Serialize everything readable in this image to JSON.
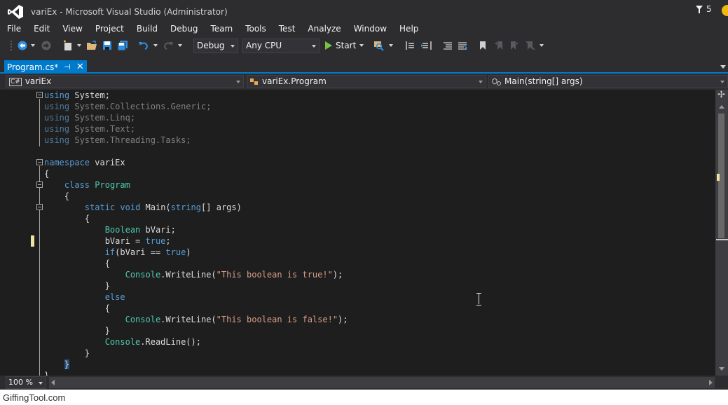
{
  "window": {
    "title": "variEx - Microsoft Visual Studio (Administrator)",
    "notification_count": "5",
    "logo_icon": "visual-studio-logo-icon"
  },
  "menu": [
    "File",
    "Edit",
    "View",
    "Project",
    "Build",
    "Debug",
    "Team",
    "Tools",
    "Test",
    "Analyze",
    "Window",
    "Help"
  ],
  "toolbar": {
    "configuration": "Debug",
    "platform": "Any CPU",
    "start_label": "Start"
  },
  "tab": {
    "label": "Program.cs*",
    "pin_icon": "pin-icon",
    "close_icon": "close-icon"
  },
  "navbar": {
    "project": "variEx",
    "class": "variEx.Program",
    "member": "Main(string[] args)"
  },
  "editor": {
    "zoom": "100 %",
    "lines": [
      [
        "<span class=\"k\">using</span> System;"
      ],
      [
        "<span class=\"k\">using</span> System.Collections.Generic;"
      ],
      [
        "<span class=\"k\">using</span> System.Linq;"
      ],
      [
        "<span class=\"k\">using</span> System.Text;"
      ],
      [
        "<span class=\"k\">using</span> System.Threading.Tasks;"
      ]
    ]
  },
  "code": [
    {
      "row": 0,
      "fold": true,
      "dim": false,
      "parts": [
        [
          "k",
          "using"
        ],
        [
          "",
          " System;"
        ]
      ]
    },
    {
      "row": 1,
      "fold": false,
      "dim": true,
      "parts": [
        [
          "k",
          "using"
        ],
        [
          "",
          " System.Collections.Generic;"
        ]
      ]
    },
    {
      "row": 2,
      "fold": false,
      "dim": true,
      "parts": [
        [
          "k",
          "using"
        ],
        [
          "",
          " System.Linq;"
        ]
      ]
    },
    {
      "row": 3,
      "fold": false,
      "dim": true,
      "parts": [
        [
          "k",
          "using"
        ],
        [
          "",
          " System.Text;"
        ]
      ]
    },
    {
      "row": 4,
      "fold": false,
      "dim": true,
      "parts": [
        [
          "k",
          "using"
        ],
        [
          "",
          " System.Threading.Tasks;"
        ]
      ]
    },
    {
      "row": 6,
      "fold": true,
      "dim": false,
      "parts": [
        [
          "k",
          "namespace"
        ],
        [
          "",
          " variEx"
        ]
      ]
    },
    {
      "row": 7,
      "fold": false,
      "dim": false,
      "parts": [
        [
          "",
          "{"
        ]
      ]
    },
    {
      "row": 8,
      "fold": true,
      "dim": false,
      "parts": [
        [
          "",
          "    "
        ],
        [
          "k",
          "class"
        ],
        [
          "",
          " "
        ],
        [
          "t",
          "Program"
        ]
      ]
    },
    {
      "row": 9,
      "fold": false,
      "dim": false,
      "parts": [
        [
          "",
          "    {"
        ]
      ]
    },
    {
      "row": 10,
      "fold": true,
      "dim": false,
      "parts": [
        [
          "",
          "        "
        ],
        [
          "k",
          "static"
        ],
        [
          "",
          " "
        ],
        [
          "k",
          "void"
        ],
        [
          "",
          " Main("
        ],
        [
          "k",
          "string"
        ],
        [
          "",
          "[] args)"
        ]
      ]
    },
    {
      "row": 11,
      "fold": false,
      "dim": false,
      "parts": [
        [
          "",
          "        {"
        ]
      ]
    },
    {
      "row": 12,
      "fold": false,
      "dim": false,
      "parts": [
        [
          "",
          "            "
        ],
        [
          "t",
          "Boolean"
        ],
        [
          "",
          " bVari;"
        ]
      ]
    },
    {
      "row": 13,
      "fold": false,
      "dim": false,
      "parts": [
        [
          "",
          "            bVari = "
        ],
        [
          "k",
          "true"
        ],
        [
          "",
          ";"
        ]
      ]
    },
    {
      "row": 14,
      "fold": false,
      "dim": false,
      "parts": [
        [
          "",
          "            "
        ],
        [
          "k",
          "if"
        ],
        [
          "",
          "(bVari == "
        ],
        [
          "k",
          "true"
        ],
        [
          "",
          ")"
        ]
      ]
    },
    {
      "row": 15,
      "fold": false,
      "dim": false,
      "parts": [
        [
          "",
          "            {"
        ]
      ]
    },
    {
      "row": 16,
      "fold": false,
      "dim": false,
      "parts": [
        [
          "",
          "                "
        ],
        [
          "t",
          "Console"
        ],
        [
          "",
          ".WriteLine("
        ],
        [
          "s",
          "\"This boolean is true!\""
        ],
        [
          "",
          ");"
        ]
      ]
    },
    {
      "row": 17,
      "fold": false,
      "dim": false,
      "parts": [
        [
          "",
          "            }"
        ]
      ]
    },
    {
      "row": 18,
      "fold": false,
      "dim": false,
      "parts": [
        [
          "",
          "            "
        ],
        [
          "k",
          "else"
        ]
      ]
    },
    {
      "row": 19,
      "fold": false,
      "dim": false,
      "parts": [
        [
          "",
          "            {"
        ]
      ]
    },
    {
      "row": 20,
      "fold": false,
      "dim": false,
      "parts": [
        [
          "",
          "                "
        ],
        [
          "t",
          "Console"
        ],
        [
          "",
          ".WriteLine("
        ],
        [
          "s",
          "\"This boolean is false!\""
        ],
        [
          "",
          ");"
        ]
      ]
    },
    {
      "row": 21,
      "fold": false,
      "dim": false,
      "parts": [
        [
          "",
          "            }"
        ]
      ]
    },
    {
      "row": 22,
      "fold": false,
      "dim": false,
      "parts": [
        [
          "",
          "            "
        ],
        [
          "t",
          "Console"
        ],
        [
          "",
          ".ReadLine();"
        ]
      ]
    },
    {
      "row": 23,
      "fold": false,
      "dim": false,
      "parts": [
        [
          "",
          "        }"
        ]
      ]
    },
    {
      "row": 24,
      "fold": false,
      "dim": false,
      "parts": [
        [
          "",
          "    "
        ],
        [
          "",
          "}"
        ]
      ]
    },
    {
      "row": 25,
      "fold": false,
      "dim": false,
      "parts": [
        [
          "",
          "}"
        ]
      ]
    }
  ],
  "colors": {
    "accent": "#007acc",
    "keyword": "#569cd6",
    "type": "#4ec9b0",
    "string": "#d69d85",
    "editor_bg": "#1e1e1e",
    "chrome_bg": "#2d2d30"
  },
  "watermark": "GiffingTool.com"
}
